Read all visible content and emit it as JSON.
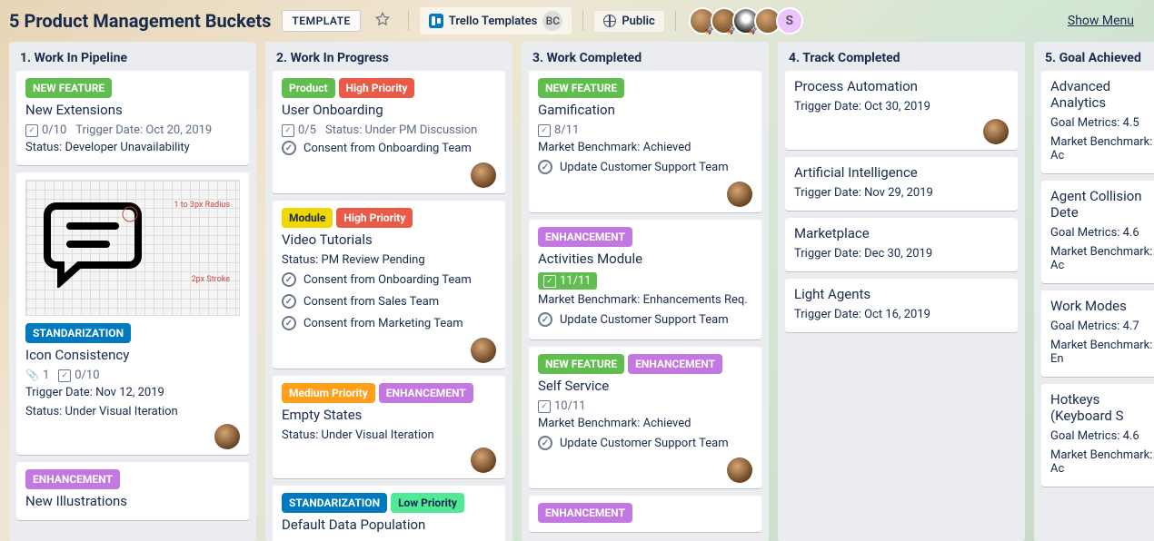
{
  "header": {
    "title": "5 Product Management Buckets",
    "template_label": "TEMPLATE",
    "workspace": "Trello Templates",
    "workspace_badge": "BC",
    "visibility": "Public",
    "avatar_s": "S",
    "show_menu": "Show Menu"
  },
  "lists": [
    {
      "title": "1. Work In Pipeline",
      "cards": [
        {
          "labels": [
            {
              "text": "NEW FEATURE",
              "cls": "newfeature"
            }
          ],
          "title": "New Extensions",
          "checklist": "0/10",
          "trigger": "Trigger Date: Oct 20, 2019",
          "lines": [
            "Status: Developer Unavailability"
          ]
        },
        {
          "cover": true,
          "cover_r1": "1 to 3px Radius",
          "cover_r2": "2px Stroke",
          "labels": [
            {
              "text": "STANDARIZATION",
              "cls": "standarization"
            }
          ],
          "title": "Icon Consistency",
          "attach": "1",
          "checklist": "0/10",
          "lines": [
            "Trigger Date: Nov 12, 2019",
            "Status: Under Visual Iteration"
          ],
          "avatar": true
        },
        {
          "labels": [
            {
              "text": "ENHANCEMENT",
              "cls": "enhancement"
            }
          ],
          "title": "New Illustrations"
        }
      ]
    },
    {
      "title": "2. Work In Progress",
      "cards": [
        {
          "labels": [
            {
              "text": "Product",
              "cls": "product"
            },
            {
              "text": "High Priority",
              "cls": "highpriority"
            }
          ],
          "title": "User Onboarding",
          "checklist": "0/5",
          "status": "Status: Under PM Discussion",
          "checks": [
            "Consent from Onboarding Team"
          ],
          "avatar": true
        },
        {
          "labels": [
            {
              "text": "Module",
              "cls": "module"
            },
            {
              "text": "High Priority",
              "cls": "highpriority"
            }
          ],
          "title": "Video Tutorials",
          "lines": [
            "Status: PM Review Pending"
          ],
          "checks": [
            "Consent from Onboarding Team",
            "Consent from Sales Team",
            "Consent from Marketing Team"
          ],
          "avatar": true
        },
        {
          "labels": [
            {
              "text": "Medium Priority",
              "cls": "mediumpriority"
            },
            {
              "text": "ENHANCEMENT",
              "cls": "enhancement"
            }
          ],
          "title": "Empty States",
          "lines": [
            "Status: Under Visual Iteration"
          ],
          "avatar": true
        },
        {
          "labels": [
            {
              "text": "STANDARIZATION",
              "cls": "standarization"
            },
            {
              "text": "Low Priority",
              "cls": "lowpriority"
            }
          ],
          "title": "Default Data Population"
        }
      ]
    },
    {
      "title": "3. Work Completed",
      "cards": [
        {
          "labels": [
            {
              "text": "NEW FEATURE",
              "cls": "newfeature"
            }
          ],
          "title": "Gamification",
          "checklist": "8/11",
          "lines": [
            "Market Benchmark: Achieved"
          ],
          "checks": [
            "Update Customer Support Team"
          ],
          "avatar": true
        },
        {
          "labels": [
            {
              "text": "ENHANCEMENT",
              "cls": "enhancement"
            }
          ],
          "title": "Activities Module",
          "checklist_done": "11/11",
          "lines": [
            "Market Benchmark: Enhancements Req."
          ],
          "checks": [
            "Update Customer Support Team"
          ]
        },
        {
          "labels": [
            {
              "text": "NEW FEATURE",
              "cls": "newfeature"
            },
            {
              "text": "ENHANCEMENT",
              "cls": "enhancement"
            }
          ],
          "title": "Self Service",
          "checklist": "10/11",
          "lines": [
            "Market Benchmark: Achieved"
          ],
          "checks": [
            "Update Customer Support Team"
          ],
          "avatar": true
        },
        {
          "labels": [
            {
              "text": "ENHANCEMENT",
              "cls": "enhancement"
            }
          ]
        }
      ]
    },
    {
      "title": "4. Track Completed",
      "cards": [
        {
          "title": "Process Automation",
          "lines": [
            "Trigger Date: Oct 30, 2019"
          ],
          "avatar": true
        },
        {
          "title": "Artificial Intelligence",
          "lines": [
            "Trigger Date: Nov 29, 2019"
          ]
        },
        {
          "title": "Marketplace",
          "lines": [
            "Trigger Date: Dec 30, 2019"
          ]
        },
        {
          "title": "Light Agents",
          "lines": [
            "Trigger Date: Oct 16, 2019"
          ]
        }
      ]
    },
    {
      "title": "5. Goal Achieved",
      "cards": [
        {
          "title": "Advanced Analytics",
          "lines": [
            "Goal Metrics: 4.5",
            "Market Benchmark: Ac"
          ]
        },
        {
          "title": "Agent Collision Dete",
          "lines": [
            "Goal Metrics: 4.6",
            "Market Benchmark: Ac"
          ]
        },
        {
          "title": "Work Modes",
          "lines": [
            "Goal Metrics: 4.7",
            "Market Benchmark: En"
          ]
        },
        {
          "title": "Hotkeys (Keyboard S",
          "lines": [
            "Goal Metrics: 4.6",
            "Market Benchmark: Ac"
          ]
        }
      ]
    }
  ]
}
